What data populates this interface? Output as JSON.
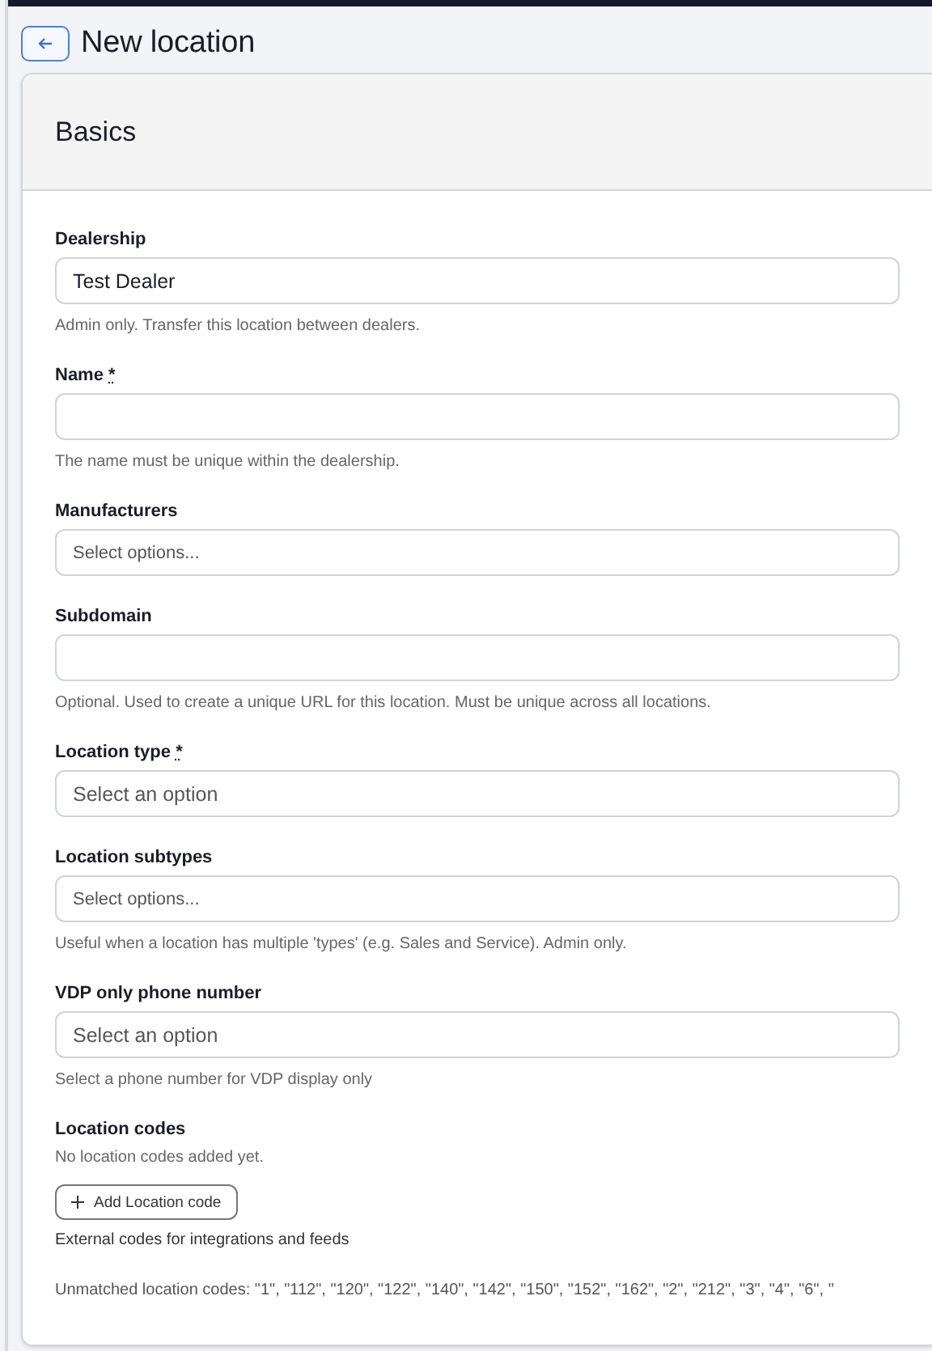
{
  "page": {
    "title": "New location"
  },
  "section": {
    "title": "Basics"
  },
  "fields": [
    {
      "kind": "text",
      "label": "Dealership",
      "value": "Test Dealer",
      "help": "Admin only. Transfer this location between dealers."
    },
    {
      "kind": "text",
      "label": "Name",
      "required_mark": "*",
      "help": "The name must be unique within the dealership."
    },
    {
      "kind": "multiselect",
      "label": "Manufacturers",
      "placeholder": "Select options..."
    },
    {
      "kind": "text",
      "label": "Subdomain",
      "help": "Optional. Used to create a unique URL for this location. Must be unique across all locations."
    },
    {
      "kind": "select",
      "label": "Location type",
      "required_mark": "*",
      "placeholder": "Select an option"
    },
    {
      "kind": "multiselect",
      "label": "Location subtypes",
      "placeholder": "Select options...",
      "help": "Useful when a location has multiple 'types' (e.g. Sales and Service). Admin only."
    },
    {
      "kind": "select",
      "label": "VDP only phone number",
      "placeholder": "Select an option",
      "help": "Select a phone number for VDP display only"
    }
  ],
  "location_codes": {
    "label": "Location codes",
    "empty_text": "No location codes added yet.",
    "add_button": "Add Location code",
    "help": "External codes for integrations and feeds",
    "unmatched": "Unmatched location codes: \"1\", \"112\", \"120\", \"122\", \"140\", \"142\", \"150\", \"152\", \"162\", \"2\", \"212\", \"3\", \"4\", \"6\", \""
  }
}
